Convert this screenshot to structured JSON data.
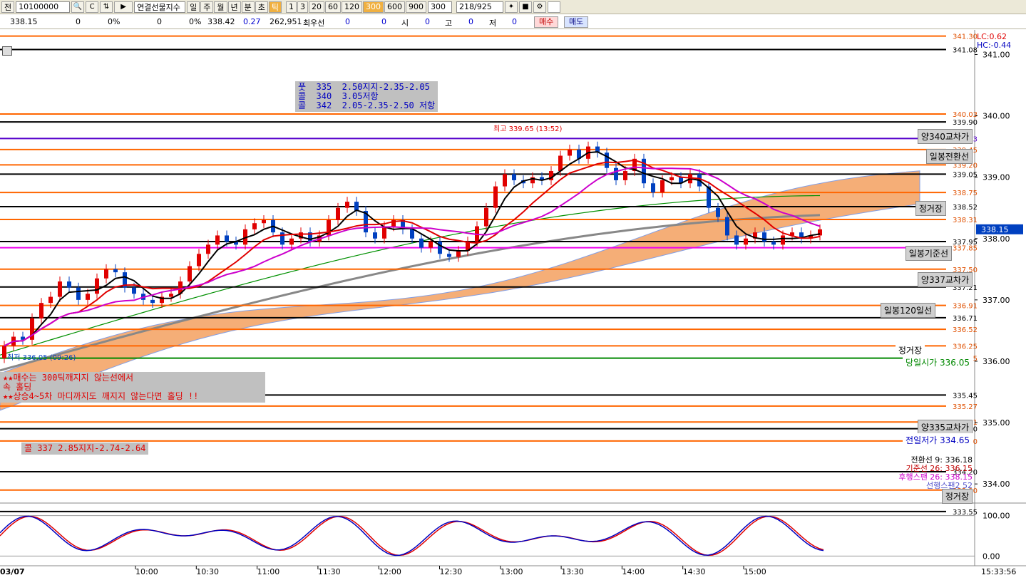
{
  "toolbar": {
    "code": "10100000",
    "name": "연결선물지수",
    "periods": [
      "일",
      "주",
      "월",
      "년",
      "분",
      "초",
      "틱"
    ],
    "active_period": "틱",
    "ticks": [
      "1",
      "3",
      "20",
      "60",
      "120",
      "300",
      "600",
      "900"
    ],
    "active_tick": "300",
    "tick_value": "300",
    "count": "218/925",
    "first_label": "전"
  },
  "quote": {
    "price": "338.15",
    "v1": "0",
    "p1": "0%",
    "v2": "0",
    "p2": "0%",
    "last": "338.42",
    "change": "0.27",
    "volume": "262,951",
    "label_best": "최우선",
    "best1": "0",
    "best2": "0",
    "label_open": "시",
    "open": "0",
    "label_high": "고",
    "high": "0",
    "label_low": "저",
    "low": "0",
    "buy_label": "매수",
    "sell_label": "매도"
  },
  "lc_hc": {
    "lc": "LC:0.62",
    "hc": "HC:-0.44"
  },
  "annotations": {
    "box1": "풋  335  2.50지지-2.35-2.05\n콜  340  3.05저항\n콜  342  2.05-2.35-2.50 저항",
    "box2": "★★매수는 300틱깨지지 않는선에서\n속 홀딩\n★★상승4~5차 마디까지도 깨지지 않는다면 홀딩 !!",
    "box3": "콜 337 2.85지지-2.74-2.64",
    "high_text": "최고 339.65 (13:52)",
    "low_text": "최저 336.05 (09:26)"
  },
  "level_labels": {
    "yang340": "양340교차가",
    "daily_conv": "일봉전환선",
    "jeonggeo1": "정거장",
    "daily_base": "일봉기준선",
    "yang337": "양337교차가",
    "daily120": "일봉120일선",
    "jeonggeo2": "정거장",
    "open_price": "당일시가 336.05",
    "yang335": "양335교차가",
    "prev_low": "전일저가 334.65",
    "jeonggeo3": "정거장"
  },
  "bottom_legend": [
    "전환선 9: 336.18",
    "기준선 26: 336.15",
    "후행스팬 26: 338.15",
    "선행스팬2 52"
  ],
  "current_price_tag": "338.15",
  "osc_labels": [
    "100.00",
    "0.00"
  ],
  "clock": "15:33:56",
  "date_label": "03/07",
  "chart_data": {
    "type": "candlestick",
    "ylim": [
      333.7,
      341.4
    ],
    "y_ticks": [
      "341.00",
      "340.00",
      "339.00",
      "338.00",
      "337.00",
      "336.00",
      "335.00",
      "334.00"
    ],
    "x_ticks": [
      "10:00",
      "10:30",
      "11:00",
      "11:30",
      "12:00",
      "12:30",
      "13:00",
      "13:30",
      "14:00",
      "14:30",
      "15:00"
    ],
    "price_levels": [
      {
        "value": 341.3,
        "color": "#ff6600",
        "label": "341.30"
      },
      {
        "value": 341.08,
        "color": "#000000",
        "label": "341.08"
      },
      {
        "value": 340.03,
        "color": "#ff6600",
        "label": "340.03"
      },
      {
        "value": 339.9,
        "color": "#000000",
        "label": "339.90"
      },
      {
        "value": 339.63,
        "color": "#5500cc",
        "label": "339.63"
      },
      {
        "value": 339.45,
        "color": "#ff6600",
        "label": "339.45"
      },
      {
        "value": 339.2,
        "color": "#ff6600",
        "label": "339.20"
      },
      {
        "value": 339.05,
        "color": "#000000",
        "label": "339.05"
      },
      {
        "value": 338.75,
        "color": "#ff6600",
        "label": "338.75"
      },
      {
        "value": 338.52,
        "color": "#000000",
        "label": "338.52"
      },
      {
        "value": 338.31,
        "color": "#ff6600",
        "label": "338.31"
      },
      {
        "value": 337.95,
        "color": "#000000",
        "label": "337.95"
      },
      {
        "value": 337.85,
        "color": "#ee00ee",
        "label": "337.85"
      },
      {
        "value": 337.5,
        "color": "#ff6600",
        "label": "337.50"
      },
      {
        "value": 337.21,
        "color": "#000000",
        "label": "337.21"
      },
      {
        "value": 336.91,
        "color": "#ff6600",
        "label": "336.91"
      },
      {
        "value": 336.71,
        "color": "#000000",
        "label": "336.71"
      },
      {
        "value": 336.52,
        "color": "#ff6600",
        "label": "336.52"
      },
      {
        "value": 336.25,
        "color": "#ff6600",
        "label": "336.25"
      },
      {
        "value": 336.05,
        "color": "#008800",
        "label": "336.05"
      },
      {
        "value": 335.45,
        "color": "#000000",
        "label": "335.45"
      },
      {
        "value": 335.27,
        "color": "#ff6600",
        "label": "335.27"
      },
      {
        "value": 335.01,
        "color": "#ff6600",
        "label": "335.01"
      },
      {
        "value": 334.9,
        "color": "#000000",
        "label": "334.90"
      },
      {
        "value": 334.7,
        "color": "#ff6600",
        "label": "334.70"
      },
      {
        "value": 334.2,
        "color": "#000000",
        "label": "334.20"
      },
      {
        "value": 333.9,
        "color": "#ff6600",
        "label": "333.90"
      },
      {
        "value": 333.55,
        "color": "#000000",
        "label": "333.55"
      }
    ],
    "close": [
      336.25,
      336.4,
      336.35,
      336.7,
      336.95,
      337.05,
      337.3,
      337.2,
      337.0,
      337.1,
      337.35,
      337.5,
      337.45,
      337.2,
      337.1,
      337.0,
      336.95,
      337.05,
      337.1,
      337.3,
      337.55,
      337.75,
      337.9,
      338.05,
      337.95,
      337.9,
      338.15,
      338.25,
      338.3,
      338.1,
      337.9,
      338.0,
      338.1,
      337.95,
      338.05,
      338.3,
      338.5,
      338.6,
      338.45,
      338.1,
      338.0,
      338.2,
      338.3,
      338.15,
      338.0,
      337.85,
      337.95,
      337.75,
      337.7,
      337.8,
      337.95,
      338.2,
      338.5,
      338.85,
      339.05,
      338.95,
      338.9,
      339.0,
      338.95,
      339.1,
      339.35,
      339.45,
      339.3,
      339.5,
      339.4,
      339.15,
      338.95,
      339.1,
      339.3,
      338.9,
      338.75,
      338.95,
      339.0,
      338.9,
      339.05,
      338.85,
      338.5,
      338.35,
      338.05,
      337.9,
      338.0,
      338.1,
      337.95,
      337.9,
      338.05,
      338.1,
      338.0,
      338.05,
      338.15
    ]
  }
}
